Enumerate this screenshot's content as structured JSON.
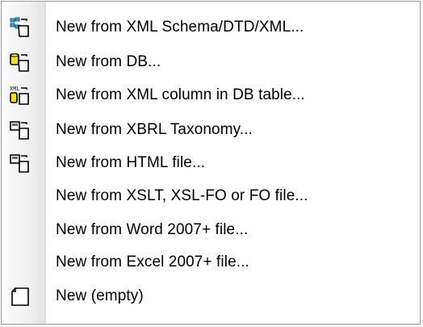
{
  "menu": {
    "items": [
      {
        "label": "New from XML Schema/DTD/XML...",
        "icon": "xml-schema-icon"
      },
      {
        "label": "New from DB...",
        "icon": "database-icon"
      },
      {
        "label": "New from XML column in DB table...",
        "icon": "xml-db-column-icon"
      },
      {
        "label": "New from XBRL Taxonomy...",
        "icon": "xbrl-taxonomy-icon"
      },
      {
        "label": "New from HTML file...",
        "icon": "html-file-icon"
      },
      {
        "label": "New from XSLT, XSL-FO or FO file...",
        "icon": ""
      },
      {
        "label": "New from Word 2007+ file...",
        "icon": ""
      },
      {
        "label": "New from Excel 2007+ file...",
        "icon": ""
      },
      {
        "label": "New (empty)",
        "icon": "new-document-icon"
      }
    ]
  }
}
